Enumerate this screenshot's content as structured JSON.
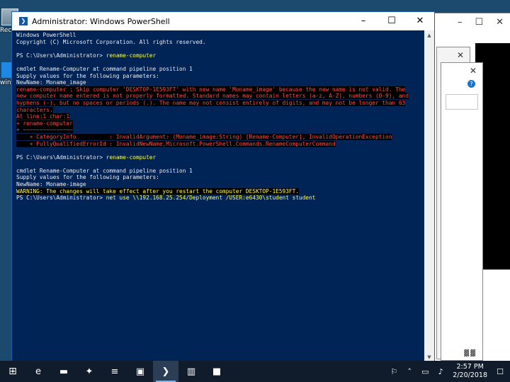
{
  "desktop": {
    "icons": [
      {
        "label": "Recy",
        "icon": "recycle-bin-icon"
      },
      {
        "label": "wind",
        "icon": "windows-logo-icon"
      }
    ]
  },
  "background_windows": {
    "status_text": "▓▓"
  },
  "powershell": {
    "title": "Administrator: Windows PowerShell",
    "controls": {
      "minimize": "–",
      "maximize": "☐",
      "close": "✕"
    },
    "lines": [
      {
        "text": "Windows PowerShell",
        "style": "normal"
      },
      {
        "text": "Copyright (C) Microsoft Corporation. All rights reserved.",
        "style": "normal"
      },
      {
        "text": "",
        "style": "normal"
      },
      {
        "prompt": "PS C:\\Users\\Administrator> ",
        "command": "rename-computer",
        "style": "prompt"
      },
      {
        "text": "",
        "style": "normal"
      },
      {
        "text": "cmdlet Rename-Computer at command pipeline position 1",
        "style": "normal"
      },
      {
        "text": "Supply values for the following parameters:",
        "style": "normal"
      },
      {
        "text": "NewName: Moname_image",
        "style": "normal"
      },
      {
        "text": "rename-computer : Skip computer 'DESKTOP-1E593FT' with new name 'Moname_image' because the new name is not valid. The",
        "style": "error"
      },
      {
        "text": "new computer name entered is not properly formatted. Standard names may contain letters (a-z, A-Z), numbers (0-9), and",
        "style": "error"
      },
      {
        "text": "hyphens (-), but no spaces or periods (.). The name may not consist entirely of digits, and may not be longer than 63",
        "style": "error"
      },
      {
        "text": "characters.",
        "style": "error"
      },
      {
        "text": "At line:1 char:1",
        "style": "error"
      },
      {
        "text": "+ rename-computer",
        "style": "error"
      },
      {
        "text": "+ ~~~~~~~~~~~~~~~",
        "style": "error"
      },
      {
        "text": "    + CategoryInfo          : InvalidArgument: (Moname_image:String) [Rename-Computer], InvalidOperationException",
        "style": "error"
      },
      {
        "text": "    + FullyQualifiedErrorId : InvalidNewName,Microsoft.PowerShell.Commands.RenameComputerCommand",
        "style": "error"
      },
      {
        "text": "",
        "style": "normal"
      },
      {
        "prompt": "PS C:\\Users\\Administrator> ",
        "command": "rename-computer",
        "style": "prompt"
      },
      {
        "text": "",
        "style": "normal"
      },
      {
        "text": "cmdlet Rename-Computer at command pipeline position 1",
        "style": "normal"
      },
      {
        "text": "Supply values for the following parameters:",
        "style": "normal"
      },
      {
        "text": "NewName: Moname-image",
        "style": "normal"
      },
      {
        "text": "WARNING: The changes will take effect after you restart the computer DESKTOP-1E593FT.",
        "style": "warning"
      },
      {
        "prompt": "PS C:\\Users\\Administrator> ",
        "command": "net use \\\\192.168.25.254/Deployment /USER:e6430\\student student",
        "style": "prompt"
      }
    ]
  },
  "taskbar": {
    "apps": [
      {
        "name": "start",
        "glyph": "⊞",
        "icon": "windows-start-icon",
        "active": false
      },
      {
        "name": "edge",
        "glyph": "e",
        "icon": "edge-browser-icon",
        "active": false
      },
      {
        "name": "file-explorer",
        "glyph": "▬",
        "icon": "folder-icon",
        "active": false
      },
      {
        "name": "deployment",
        "glyph": "✦",
        "icon": "deployment-tool-icon",
        "active": false
      },
      {
        "name": "notepad",
        "glyph": "≡",
        "icon": "notepad-icon",
        "active": false
      },
      {
        "name": "remote-desktop",
        "glyph": "▣",
        "icon": "remote-desktop-icon",
        "active": false
      },
      {
        "name": "powershell",
        "glyph": "❯",
        "icon": "powershell-icon",
        "active": true
      },
      {
        "name": "server-manager",
        "glyph": "▥",
        "icon": "server-manager-icon",
        "active": false
      },
      {
        "name": "command-prompt",
        "glyph": "■",
        "icon": "command-prompt-icon",
        "active": false
      }
    ],
    "tray": {
      "people_glyph": "⚐",
      "chevron_glyph": "˄",
      "network_glyph": "▭",
      "volume_glyph": "♪",
      "time": "2:57 PM",
      "date": "2/20/2018",
      "notification_glyph": "☐"
    }
  },
  "colors": {
    "console_background": "#012456",
    "console_text": "#eeedf0",
    "error_text": "#ff4a4a",
    "warning_text": "#ffff4e",
    "prompt_command": "#ffff4e",
    "desktop_background": "#1b4a6e",
    "taskbar_background": "#101c2b"
  }
}
